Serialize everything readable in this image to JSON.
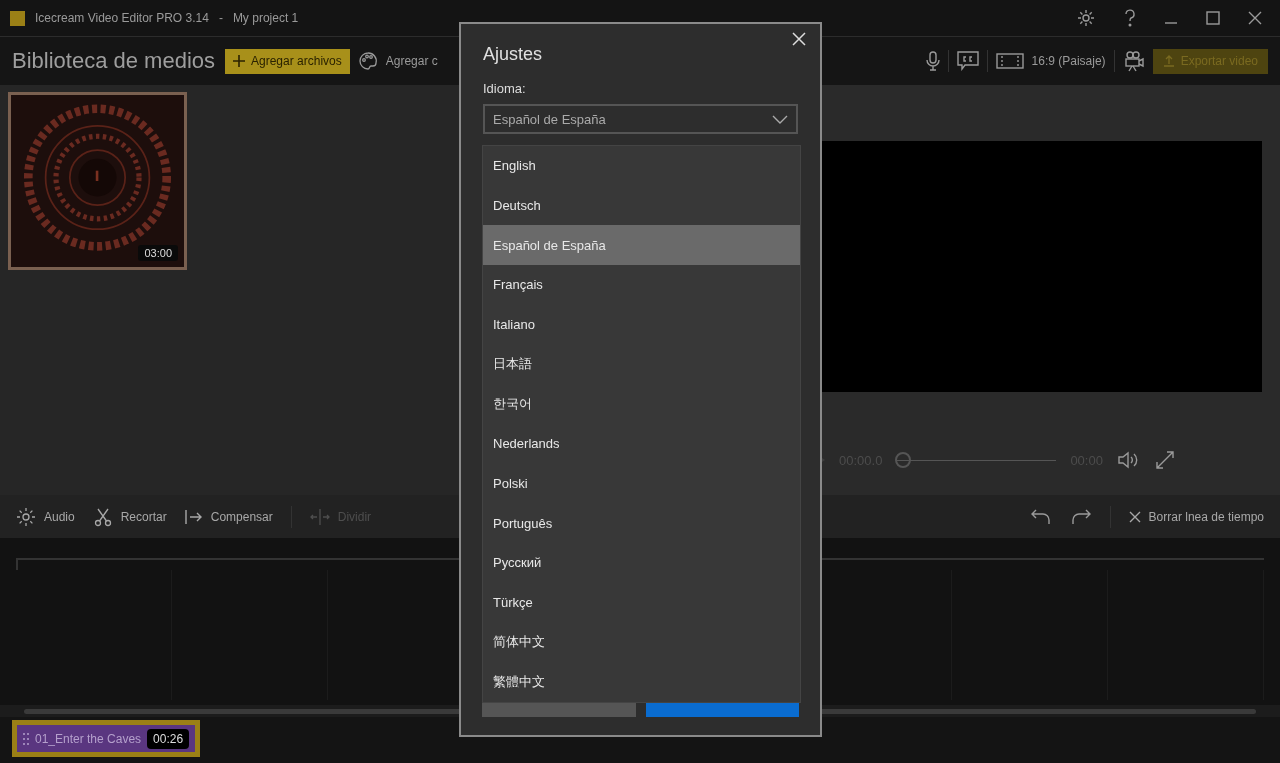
{
  "window": {
    "title": "Icecream Video Editor PRO 3.14",
    "separator": "-",
    "project": "My project 1"
  },
  "toolbar": {
    "heading": "Biblioteca de medios",
    "add_files": "Agregar archivos",
    "add_color": "Agregar c",
    "aspect": "16:9 (Paisaje)",
    "export": "Exportar video"
  },
  "media": [
    {
      "kind": "picture",
      "duration": "03:00",
      "selected": true
    }
  ],
  "player": {
    "current": "00:00.0",
    "total": "00:00",
    "level": 0
  },
  "tools": [
    {
      "label": "Audio",
      "disabled": false
    },
    {
      "label": "Recortar",
      "disabled": false
    },
    {
      "label": "Compensar",
      "disabled": false
    },
    {
      "label": "Dividir",
      "disabled": true
    }
  ],
  "clear_timeline": "Borrar lnea de tiempo",
  "track": {
    "name": "01_Enter the Caves",
    "duration": "00:26"
  },
  "dialog": {
    "title": "Ajustes",
    "language_label": "Idioma:",
    "language_value": "Español de España",
    "options": [
      {
        "label": "English",
        "selected": false
      },
      {
        "label": "Deutsch",
        "selected": false
      },
      {
        "label": "Español de España",
        "selected": true
      },
      {
        "label": "Français",
        "selected": false
      },
      {
        "label": "Italiano",
        "selected": false
      },
      {
        "label": "日本語",
        "selected": false
      },
      {
        "label": "한국어",
        "selected": false
      },
      {
        "label": "Nederlands",
        "selected": false
      },
      {
        "label": "Polski",
        "selected": false
      },
      {
        "label": "Português",
        "selected": false
      },
      {
        "label": "Русский",
        "selected": false
      },
      {
        "label": "Türkçe",
        "selected": false
      },
      {
        "label": "简体中文",
        "selected": false
      },
      {
        "label": "繁體中文",
        "selected": false
      }
    ]
  }
}
